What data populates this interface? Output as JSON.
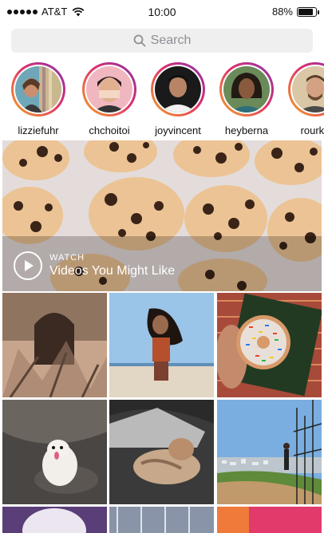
{
  "status_bar": {
    "carrier": "AT&T",
    "time": "10:00",
    "battery": "88%",
    "battery_level": 0.88
  },
  "search": {
    "placeholder": "Search",
    "icon": "search-icon"
  },
  "stories": [
    {
      "username": "lizziefuhr"
    },
    {
      "username": "chchoitoi"
    },
    {
      "username": "joyvincent"
    },
    {
      "username": "heyberna"
    },
    {
      "username": "rourke"
    }
  ],
  "featured": {
    "kicker": "WATCH",
    "title": "Videos You Might Like",
    "icon": "play-icon"
  },
  "colors": {
    "story_ring_start": "#f5a623",
    "story_ring_mid": "#e1306c",
    "story_ring_end": "#8134af",
    "search_bg": "#efeff0"
  }
}
